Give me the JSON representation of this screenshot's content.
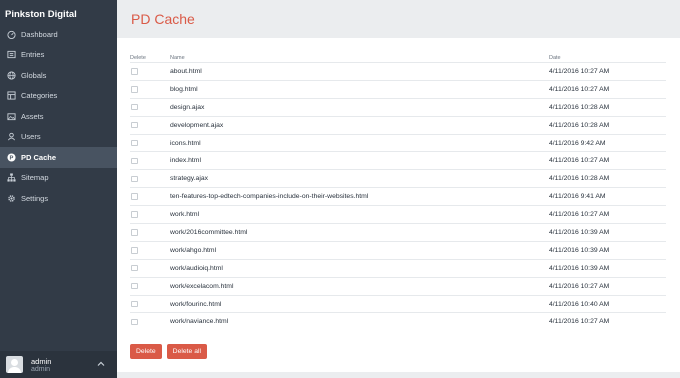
{
  "sidebar": {
    "site_name": "Pinkston Digital",
    "items": [
      {
        "label": "Dashboard",
        "icon": "dashboard-icon"
      },
      {
        "label": "Entries",
        "icon": "entries-icon"
      },
      {
        "label": "Globals",
        "icon": "globe-icon"
      },
      {
        "label": "Categories",
        "icon": "categories-icon"
      },
      {
        "label": "Assets",
        "icon": "assets-icon"
      },
      {
        "label": "Users",
        "icon": "users-icon"
      },
      {
        "label": "PD Cache",
        "icon": "pd-cache-icon",
        "selected": true
      },
      {
        "label": "Sitemap",
        "icon": "sitemap-icon"
      },
      {
        "label": "Settings",
        "icon": "gear-icon"
      }
    ],
    "user": {
      "name": "admin",
      "role": "admin"
    }
  },
  "header": {
    "title": "PD Cache"
  },
  "table": {
    "columns": {
      "delete": "Delete",
      "name": "Name",
      "date": "Date"
    },
    "rows": [
      {
        "name": "about.html",
        "date": "4/11/2016 10:27 AM"
      },
      {
        "name": "blog.html",
        "date": "4/11/2016 10:27 AM"
      },
      {
        "name": "design.ajax",
        "date": "4/11/2016 10:28 AM"
      },
      {
        "name": "development.ajax",
        "date": "4/11/2016 10:28 AM"
      },
      {
        "name": "icons.html",
        "date": "4/11/2016 9:42 AM"
      },
      {
        "name": "index.html",
        "date": "4/11/2016 10:27 AM"
      },
      {
        "name": "strategy.ajax",
        "date": "4/11/2016 10:28 AM"
      },
      {
        "name": "ten-features-top-edtech-companies-include-on-their-websites.html",
        "date": "4/11/2016 9:41 AM"
      },
      {
        "name": "work.html",
        "date": "4/11/2016 10:27 AM"
      },
      {
        "name": "work/2016committee.html",
        "date": "4/11/2016 10:39 AM"
      },
      {
        "name": "work/ahgo.html",
        "date": "4/11/2016 10:39 AM"
      },
      {
        "name": "work/audioiq.html",
        "date": "4/11/2016 10:39 AM"
      },
      {
        "name": "work/excelacom.html",
        "date": "4/11/2016 10:27 AM"
      },
      {
        "name": "work/fourinc.html",
        "date": "4/11/2016 10:40 AM"
      },
      {
        "name": "work/naviance.html",
        "date": "4/11/2016 10:27 AM"
      }
    ]
  },
  "actions": {
    "delete_label": "Delete",
    "delete_all_label": "Delete all"
  },
  "colors": {
    "accent": "#da5a47",
    "sidebar_bg": "#323b47",
    "selected_bg": "#485361"
  }
}
